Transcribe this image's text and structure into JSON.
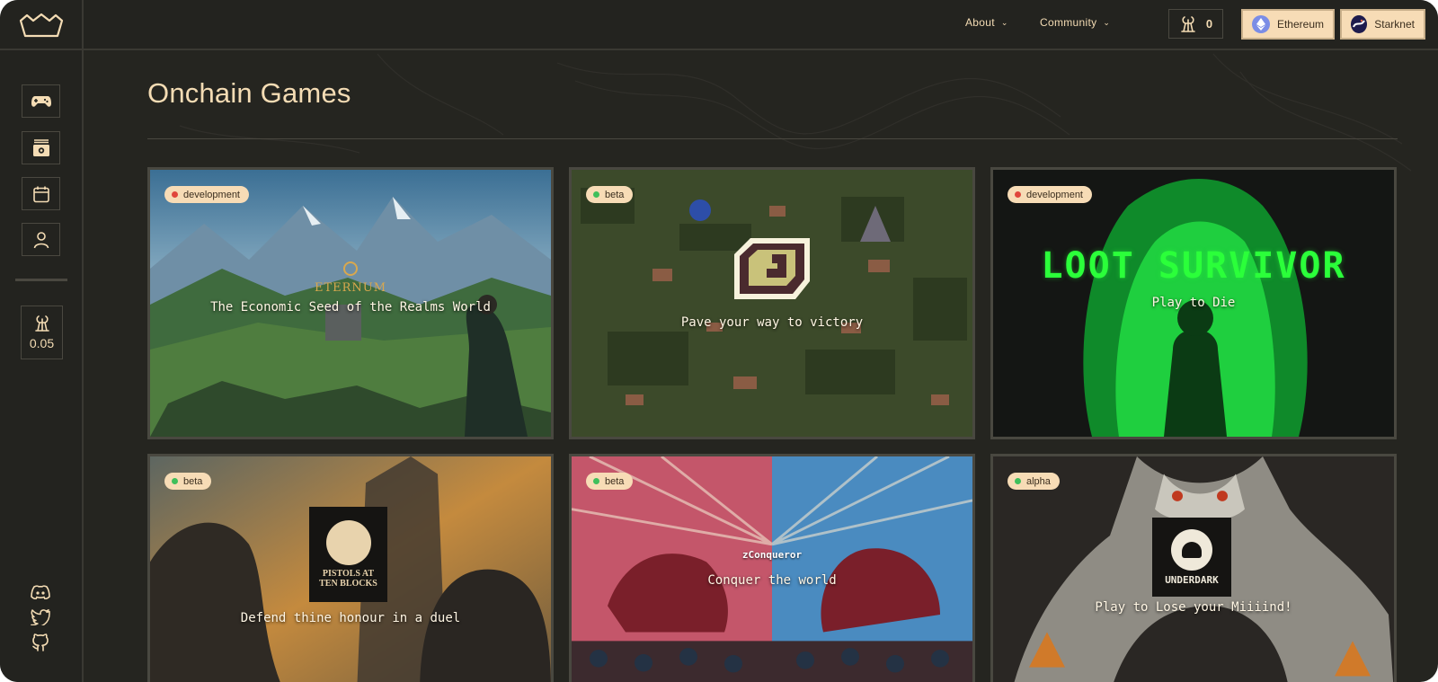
{
  "nav": {
    "about_label": "About",
    "community_label": "Community",
    "lords_balance": "0",
    "ethereum_label": "Ethereum",
    "starknet_label": "Starknet"
  },
  "sidebar": {
    "items": [
      {
        "name": "games",
        "icon": "gamepad-icon"
      },
      {
        "name": "assets",
        "icon": "chest-icon"
      },
      {
        "name": "calendar",
        "icon": "calendar-icon"
      },
      {
        "name": "account",
        "icon": "user-icon"
      }
    ],
    "lords_price": "0.05",
    "socials": [
      {
        "name": "discord",
        "icon": "discord-icon"
      },
      {
        "name": "twitter",
        "icon": "twitter-icon"
      },
      {
        "name": "github",
        "icon": "github-icon"
      }
    ]
  },
  "page": {
    "title": "Onchain Games"
  },
  "games": [
    {
      "name": "eternum",
      "status": "development",
      "status_color": "#e0463c",
      "logo": "ETERNUM",
      "tagline": "The Economic Seed of the Realms World"
    },
    {
      "name": "pixel-map",
      "status": "beta",
      "status_color": "#3fbf5b",
      "logo": "",
      "tagline": "Pave your way to victory"
    },
    {
      "name": "loot-survivor",
      "status": "development",
      "status_color": "#e0463c",
      "logo": "LOOT SURVIVOR",
      "tagline": "Play to Die"
    },
    {
      "name": "pistols",
      "status": "beta",
      "status_color": "#3fbf5b",
      "logo": "PISTOLS AT TEN BLOCKS",
      "tagline": "Defend thine honour in a duel"
    },
    {
      "name": "zconqueror",
      "status": "beta",
      "status_color": "#3fbf5b",
      "logo": "zConqueror",
      "tagline": "Conquer the world"
    },
    {
      "name": "underdark",
      "status": "alpha",
      "status_color": "#3fbf5b",
      "logo": "UNDERDARK",
      "tagline": "Play to Lose your Miiiind!"
    }
  ],
  "colors": {
    "accent": "#f7dcb6",
    "background": "#252520",
    "border": "#494840"
  }
}
